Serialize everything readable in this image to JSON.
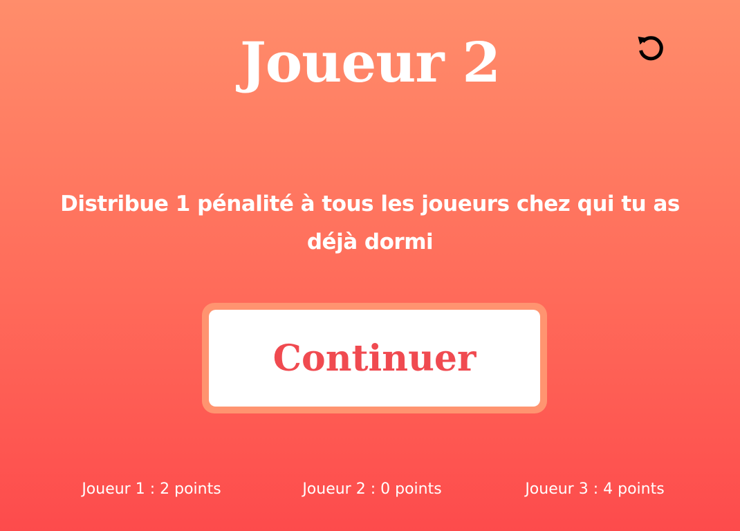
{
  "header": {
    "title": "Joueur 2",
    "reset_icon": "restart-icon"
  },
  "prompt": {
    "text": "Distribue 1 pénalité à tous les joueurs chez qui tu as déjà dormi"
  },
  "actions": {
    "continue_label": "Continuer"
  },
  "scores": [
    {
      "label": "Joueur 1 : 2 points"
    },
    {
      "label": "Joueur 2 : 0 points"
    },
    {
      "label": "Joueur 3 : 4 points"
    }
  ],
  "colors": {
    "background_top": "#FF8D6B",
    "background_bottom": "#FD4B4C",
    "button_border": "#FF9470",
    "button_text": "#F04A50",
    "text": "#FFFFFF"
  }
}
